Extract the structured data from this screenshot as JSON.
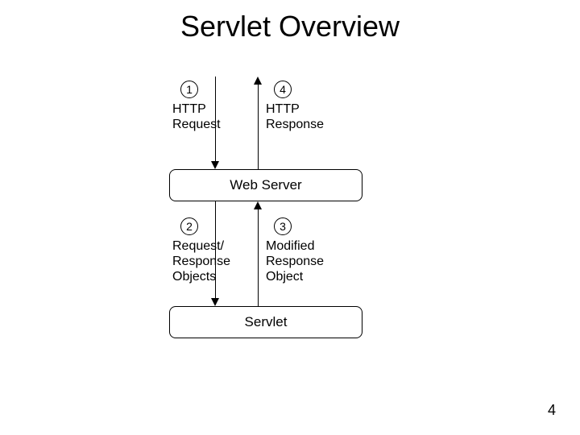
{
  "title": "Servlet Overview",
  "pageNumber": "4",
  "boxes": {
    "webserver": "Web Server",
    "servlet": "Servlet"
  },
  "steps": {
    "s1": {
      "num": "1",
      "label": "HTTP\nRequest"
    },
    "s4": {
      "num": "4",
      "label": "HTTP\nResponse"
    },
    "s2": {
      "num": "2",
      "label": "Request/\nResponse\nObjects"
    },
    "s3": {
      "num": "3",
      "label": "Modified\nResponse\nObject"
    }
  }
}
